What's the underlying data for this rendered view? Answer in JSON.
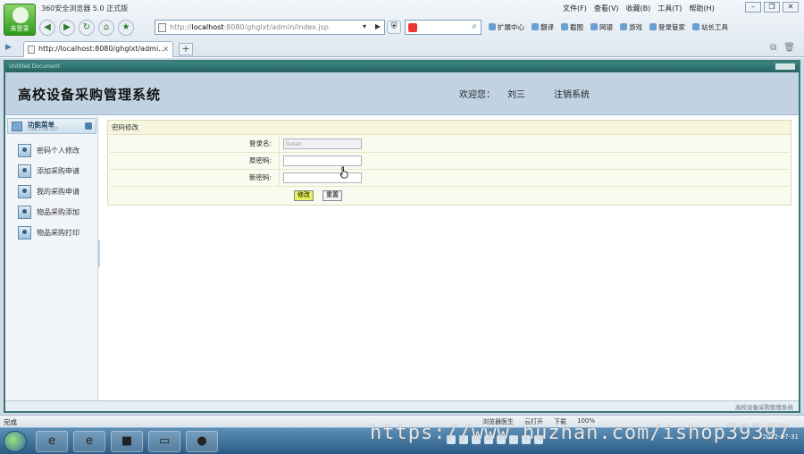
{
  "browser": {
    "title": "360安全浏览器 5.0 正式版",
    "login_label": "未登录",
    "menu": [
      "文件(F)",
      "查看(V)",
      "收藏(B)",
      "工具(T)",
      "帮助(H)"
    ],
    "address_prefix": "http://",
    "address_host": "localhost",
    "address_rest": ":8080/ghglxt/admin/index.jsp",
    "toolbar": [
      "扩展中心",
      "翻译",
      "截图",
      "网银",
      "游戏",
      "登录管家",
      "站长工具"
    ],
    "tab_title": "http://localhost:8080/ghglxt/admi...",
    "status_done": "完成",
    "status_items": [
      "浏览器医生",
      "云打开",
      "下载",
      "100%"
    ]
  },
  "app": {
    "window_title": "Untitled Document",
    "system_title": "高校设备采购管理系统",
    "welcome": "欢迎您：",
    "user": "刘三",
    "logout": "注销系统",
    "sidebar": {
      "title": "功能菜单",
      "subtitle": "FUNCTION LIST",
      "items": [
        {
          "label": "密码个人修改"
        },
        {
          "label": "添加采购申请"
        },
        {
          "label": "我的采购申请"
        },
        {
          "label": "物品采购添加"
        },
        {
          "label": "物品采购打印"
        }
      ]
    },
    "form": {
      "title": "密码修改",
      "username_label": "登录名:",
      "username_value": "liusan",
      "old_password_label": "原密码:",
      "new_password_label": "新密码:",
      "submit": "修改",
      "reset": "重置"
    },
    "footer": "高校设备采购管理系统"
  },
  "taskbar": {
    "date": "2012-07-31"
  },
  "watermark": "https://www.huzhan.com/ishop39397"
}
